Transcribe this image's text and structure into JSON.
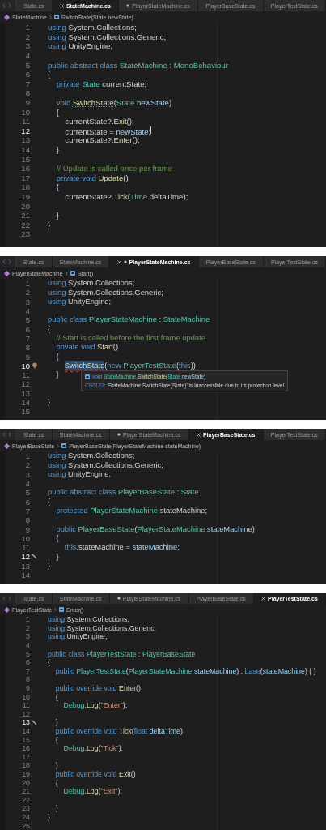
{
  "editors": [
    {
      "tabs": [
        {
          "label": "State.cs",
          "selected": false,
          "modified": false
        },
        {
          "label": "StateMachine.cs",
          "selected": true,
          "modified": false
        },
        {
          "label": "PlayerStateMachine.cs",
          "selected": false,
          "modified": true
        },
        {
          "label": "PlayerBaseState.cs",
          "selected": false,
          "modified": false
        },
        {
          "label": "PlayerTestState.cs",
          "selected": false,
          "modified": false
        }
      ],
      "breadcrumb": {
        "class_name": "StateMachine",
        "member": "SwitchState(State newState)"
      },
      "lines": [
        {
          "number": "1",
          "current": false,
          "tokens": [
            {
              "text": "using",
              "kind": "kw"
            },
            {
              "text": " System.Collections;",
              "kind": "plain"
            }
          ]
        },
        {
          "number": "2",
          "current": false,
          "tokens": [
            {
              "text": "using",
              "kind": "kw"
            },
            {
              "text": " System.Collections.Generic;",
              "kind": "plain"
            }
          ]
        },
        {
          "number": "3",
          "current": false,
          "tokens": [
            {
              "text": "using",
              "kind": "kw"
            },
            {
              "text": " UnityEngine;",
              "kind": "plain"
            }
          ]
        },
        {
          "number": "4",
          "current": false
        },
        {
          "number": "5",
          "current": false,
          "tokens": [
            {
              "text": "public abstract class",
              "kind": "kw"
            },
            {
              "text": " StateMachine",
              "kind": "type"
            },
            {
              "text": " : ",
              "kind": "plain"
            },
            {
              "text": "MonoBehaviour",
              "kind": "type"
            }
          ]
        },
        {
          "number": "6",
          "current": false,
          "tokens": [
            {
              "text": "{",
              "kind": "plain"
            }
          ]
        },
        {
          "number": "7",
          "current": false,
          "tokens": [
            {
              "text": "    private",
              "kind": "kw"
            },
            {
              "text": " State",
              "kind": "type"
            },
            {
              "text": " currentState;",
              "kind": "plain"
            }
          ]
        },
        {
          "number": "8",
          "current": false
        },
        {
          "number": "9",
          "current": false,
          "tokens": [
            {
              "text": "    void",
              "kind": "kw"
            },
            {
              "text": " SwitchState",
              "kind": "fn-hint"
            },
            {
              "text": "(",
              "kind": "plain"
            },
            {
              "text": "State",
              "kind": "type"
            },
            {
              "text": " newState",
              "kind": "var"
            },
            {
              "text": ")",
              "kind": "plain"
            }
          ]
        },
        {
          "number": "10",
          "current": false,
          "tokens": [
            {
              "text": "    {",
              "kind": "plain"
            }
          ]
        },
        {
          "number": "11",
          "current": false,
          "tokens": [
            {
              "text": "        currentState?.",
              "kind": "plain"
            },
            {
              "text": "Exit",
              "kind": "fn"
            },
            {
              "text": "();",
              "kind": "plain"
            }
          ]
        },
        {
          "number": "12",
          "current": true,
          "caret": true,
          "tokens": [
            {
              "text": "        currentState = ",
              "kind": "plain"
            },
            {
              "text": "newState",
              "kind": "var"
            },
            {
              "text": ";",
              "kind": "plain"
            }
          ]
        },
        {
          "number": "13",
          "current": false,
          "tokens": [
            {
              "text": "        currentState?.",
              "kind": "plain"
            },
            {
              "text": "Enter",
              "kind": "fn"
            },
            {
              "text": "();",
              "kind": "plain"
            }
          ]
        },
        {
          "number": "14",
          "current": false,
          "tokens": [
            {
              "text": "    }",
              "kind": "plain"
            }
          ]
        },
        {
          "number": "15",
          "current": false
        },
        {
          "number": "16",
          "current": false,
          "tokens": [
            {
              "text": "    // Update is called once per frame",
              "kind": "comment"
            }
          ]
        },
        {
          "number": "17",
          "current": false,
          "tokens": [
            {
              "text": "    private void",
              "kind": "kw"
            },
            {
              "text": " Update",
              "kind": "fn"
            },
            {
              "text": "()",
              "kind": "plain"
            }
          ]
        },
        {
          "number": "18",
          "current": false,
          "tokens": [
            {
              "text": "    {",
              "kind": "plain"
            }
          ]
        },
        {
          "number": "19",
          "current": false,
          "tokens": [
            {
              "text": "        currentState?.",
              "kind": "plain"
            },
            {
              "text": "Tick",
              "kind": "fn"
            },
            {
              "text": "(",
              "kind": "plain"
            },
            {
              "text": "Time",
              "kind": "type"
            },
            {
              "text": ".deltaTime);",
              "kind": "plain"
            }
          ]
        },
        {
          "number": "20",
          "current": false
        },
        {
          "number": "21",
          "current": false,
          "tokens": [
            {
              "text": "    }",
              "kind": "plain"
            }
          ]
        },
        {
          "number": "22",
          "current": false,
          "tokens": [
            {
              "text": "}",
              "kind": "plain"
            }
          ]
        },
        {
          "number": "23",
          "current": false
        }
      ]
    },
    {
      "tabs": [
        {
          "label": "State.cs",
          "selected": false,
          "modified": false
        },
        {
          "label": "StateMachine.cs",
          "selected": false,
          "modified": false
        },
        {
          "label": "PlayerStateMachine.cs",
          "selected": true,
          "modified": true
        },
        {
          "label": "PlayerBaseState.cs",
          "selected": false,
          "modified": false
        },
        {
          "label": "PlayerTestState.cs",
          "selected": false,
          "modified": false
        }
      ],
      "breadcrumb": {
        "class_name": "PlayerStateMachine",
        "member": "Start()"
      },
      "lines": [
        {
          "number": "1",
          "current": false,
          "tokens": [
            {
              "text": "using",
              "kind": "kw"
            },
            {
              "text": " System.Collections;",
              "kind": "plain"
            }
          ]
        },
        {
          "number": "2",
          "current": false,
          "tokens": [
            {
              "text": "using",
              "kind": "kw"
            },
            {
              "text": " System.Collections.Generic;",
              "kind": "plain"
            }
          ]
        },
        {
          "number": "3",
          "current": false,
          "tokens": [
            {
              "text": "using",
              "kind": "kw"
            },
            {
              "text": " UnityEngine;",
              "kind": "plain"
            }
          ]
        },
        {
          "number": "4",
          "current": false
        },
        {
          "number": "5",
          "current": false,
          "tokens": [
            {
              "text": "public class",
              "kind": "kw"
            },
            {
              "text": " PlayerStateMachine",
              "kind": "type"
            },
            {
              "text": " : ",
              "kind": "plain"
            },
            {
              "text": "StateMachine",
              "kind": "type"
            }
          ]
        },
        {
          "number": "6",
          "current": false,
          "tokens": [
            {
              "text": "{",
              "kind": "plain"
            }
          ]
        },
        {
          "number": "7",
          "current": false,
          "tokens": [
            {
              "text": "    // Start is called before the first frame update",
              "kind": "comment"
            }
          ]
        },
        {
          "number": "8",
          "current": false,
          "tokens": [
            {
              "text": "    private void",
              "kind": "kw"
            },
            {
              "text": " Start",
              "kind": "fn"
            },
            {
              "text": "()",
              "kind": "plain"
            }
          ]
        },
        {
          "number": "9",
          "current": false,
          "tokens": [
            {
              "text": "    {",
              "kind": "plain"
            }
          ]
        },
        {
          "number": "10",
          "current": true,
          "gutter_icon": {
            "kind": "lightbulb"
          },
          "tokens": [
            {
              "text": "        SwitchState",
              "kind": "fn-error"
            },
            {
              "text": "(",
              "kind": "plain"
            },
            {
              "text": "new",
              "kind": "kw"
            },
            {
              "text": " PlayerTestState",
              "kind": "type"
            },
            {
              "text": "(",
              "kind": "plain"
            },
            {
              "text": "this",
              "kind": "kw"
            },
            {
              "text": "));",
              "kind": "plain"
            }
          ]
        },
        {
          "number": "11",
          "current": false,
          "tokens": [
            {
              "text": "    }",
              "kind": "plain"
            }
          ]
        },
        {
          "number": "12",
          "current": false
        },
        {
          "number": "13",
          "current": false
        },
        {
          "number": "14",
          "current": false,
          "tokens": [
            {
              "text": "}",
              "kind": "plain"
            }
          ]
        },
        {
          "number": "15",
          "current": false
        }
      ],
      "tooltip": {
        "signature": [
          {
            "text": "void",
            "kind": "kw"
          },
          {
            "text": " StateMachine",
            "kind": "type"
          },
          {
            "text": ".",
            "kind": "plain"
          },
          {
            "text": "SwitchState",
            "kind": "fn"
          },
          {
            "text": "(",
            "kind": "plain"
          },
          {
            "text": "State",
            "kind": "type"
          },
          {
            "text": " newState",
            "kind": "var"
          },
          {
            "text": ")",
            "kind": "plain"
          }
        ],
        "error": [
          {
            "text": "CS0122",
            "kind": "link"
          },
          {
            "text": ": 'StateMachine.SwitchState(State)' is inaccessible due to its protection level",
            "kind": "plain"
          }
        ]
      }
    },
    {
      "tabs": [
        {
          "label": "State.cs",
          "selected": false,
          "modified": false
        },
        {
          "label": "StateMachine.cs",
          "selected": false,
          "modified": false
        },
        {
          "label": "PlayerStateMachine.cs",
          "selected": false,
          "modified": true
        },
        {
          "label": "PlayerBaseState.cs",
          "selected": true,
          "modified": false
        },
        {
          "label": "PlayerTestState.cs",
          "selected": false,
          "modified": false
        }
      ],
      "breadcrumb": {
        "class_name": "PlayerBaseState",
        "member": "PlayerBaseState(PlayerStateMachine stateMachine)"
      },
      "lines": [
        {
          "number": "1",
          "current": false,
          "tokens": [
            {
              "text": "using",
              "kind": "kw"
            },
            {
              "text": " System.Collections;",
              "kind": "plain"
            }
          ]
        },
        {
          "number": "2",
          "current": false,
          "tokens": [
            {
              "text": "using",
              "kind": "kw"
            },
            {
              "text": " System.Collections.Generic;",
              "kind": "plain"
            }
          ]
        },
        {
          "number": "3",
          "current": false,
          "tokens": [
            {
              "text": "using",
              "kind": "kw"
            },
            {
              "text": " UnityEngine;",
              "kind": "plain"
            }
          ]
        },
        {
          "number": "4",
          "current": false
        },
        {
          "number": "5",
          "current": false,
          "tokens": [
            {
              "text": "public abstract class",
              "kind": "kw"
            },
            {
              "text": " PlayerBaseState",
              "kind": "type"
            },
            {
              "text": " : ",
              "kind": "plain"
            },
            {
              "text": "State",
              "kind": "type"
            }
          ]
        },
        {
          "number": "6",
          "current": false,
          "tokens": [
            {
              "text": "{",
              "kind": "plain"
            }
          ]
        },
        {
          "number": "7",
          "current": false,
          "tokens": [
            {
              "text": "    protected",
              "kind": "kw"
            },
            {
              "text": " PlayerStateMachine",
              "kind": "type"
            },
            {
              "text": " stateMachine;",
              "kind": "plain"
            }
          ]
        },
        {
          "number": "8",
          "current": false
        },
        {
          "number": "9",
          "current": false,
          "tokens": [
            {
              "text": "    public",
              "kind": "kw"
            },
            {
              "text": " PlayerBaseState",
              "kind": "type"
            },
            {
              "text": "(",
              "kind": "plain"
            },
            {
              "text": "PlayerStateMachine",
              "kind": "type"
            },
            {
              "text": " stateMachine",
              "kind": "var"
            },
            {
              "text": ")",
              "kind": "plain"
            }
          ]
        },
        {
          "number": "10",
          "current": false,
          "tokens": [
            {
              "text": "    {",
              "kind": "plain"
            }
          ]
        },
        {
          "number": "11",
          "current": false,
          "tokens": [
            {
              "text": "        this",
              "kind": "kw"
            },
            {
              "text": ".stateMachine = ",
              "kind": "plain"
            },
            {
              "text": "stateMachine",
              "kind": "var"
            },
            {
              "text": ";",
              "kind": "plain"
            }
          ]
        },
        {
          "number": "12",
          "current": true,
          "gutter_icon": {
            "kind": "pencil"
          },
          "tokens": [
            {
              "text": "    }",
              "kind": "plain"
            }
          ]
        },
        {
          "number": "13",
          "current": false,
          "tokens": [
            {
              "text": "}",
              "kind": "plain"
            }
          ]
        },
        {
          "number": "14",
          "current": false
        }
      ]
    },
    {
      "tabs": [
        {
          "label": "State.cs",
          "selected": false,
          "modified": false
        },
        {
          "label": "StateMachine.cs",
          "selected": false,
          "modified": false
        },
        {
          "label": "PlayerStateMachine.cs",
          "selected": false,
          "modified": true
        },
        {
          "label": "PlayerBaseState.cs",
          "selected": false,
          "modified": false
        },
        {
          "label": "PlayerTestState.cs",
          "selected": true,
          "modified": false
        }
      ],
      "breadcrumb": {
        "class_name": "PlayerTestState",
        "member": "Enter()"
      },
      "lines": [
        {
          "number": "1",
          "current": false,
          "tokens": [
            {
              "text": "using",
              "kind": "kw"
            },
            {
              "text": " System.Collections;",
              "kind": "plain"
            }
          ]
        },
        {
          "number": "2",
          "current": false,
          "tokens": [
            {
              "text": "using",
              "kind": "kw"
            },
            {
              "text": " System.Collections.Generic;",
              "kind": "plain"
            }
          ]
        },
        {
          "number": "3",
          "current": false,
          "tokens": [
            {
              "text": "using",
              "kind": "kw"
            },
            {
              "text": " UnityEngine;",
              "kind": "plain"
            }
          ]
        },
        {
          "number": "4",
          "current": false
        },
        {
          "number": "5",
          "current": false,
          "tokens": [
            {
              "text": "public class",
              "kind": "kw"
            },
            {
              "text": " PlayerTestState",
              "kind": "type"
            },
            {
              "text": " : ",
              "kind": "plain"
            },
            {
              "text": "PlayerBaseState",
              "kind": "type"
            }
          ]
        },
        {
          "number": "6",
          "current": false,
          "tokens": [
            {
              "text": "{",
              "kind": "plain"
            }
          ]
        },
        {
          "number": "7",
          "current": false,
          "tokens": [
            {
              "text": "    public",
              "kind": "kw"
            },
            {
              "text": " PlayerTestState",
              "kind": "type"
            },
            {
              "text": "(",
              "kind": "plain"
            },
            {
              "text": "PlayerStateMachine",
              "kind": "type"
            },
            {
              "text": " stateMachine",
              "kind": "var"
            },
            {
              "text": ") : ",
              "kind": "plain"
            },
            {
              "text": "base",
              "kind": "kw"
            },
            {
              "text": "(",
              "kind": "plain"
            },
            {
              "text": "stateMachine",
              "kind": "var"
            },
            {
              "text": ") { }",
              "kind": "plain"
            }
          ]
        },
        {
          "number": "8",
          "current": false
        },
        {
          "number": "9",
          "current": false,
          "tokens": [
            {
              "text": "    public override void",
              "kind": "kw"
            },
            {
              "text": " Enter",
              "kind": "fn"
            },
            {
              "text": "()",
              "kind": "plain"
            }
          ]
        },
        {
          "number": "10",
          "current": false,
          "tokens": [
            {
              "text": "    {",
              "kind": "plain"
            }
          ]
        },
        {
          "number": "11",
          "current": false,
          "tokens": [
            {
              "text": "        Debug",
              "kind": "type"
            },
            {
              "text": ".",
              "kind": "plain"
            },
            {
              "text": "Log",
              "kind": "fn"
            },
            {
              "text": "(",
              "kind": "plain"
            },
            {
              "text": "\"Enter\"",
              "kind": "str"
            },
            {
              "text": ");",
              "kind": "plain"
            }
          ]
        },
        {
          "number": "12",
          "current": false
        },
        {
          "number": "13",
          "current": true,
          "gutter_icon": {
            "kind": "pencil"
          },
          "tokens": [
            {
              "text": "    }",
              "kind": "plain"
            }
          ]
        },
        {
          "number": "14",
          "current": false,
          "tokens": [
            {
              "text": "    public override void",
              "kind": "kw"
            },
            {
              "text": " Tick",
              "kind": "fn"
            },
            {
              "text": "(",
              "kind": "plain"
            },
            {
              "text": "float",
              "kind": "kw"
            },
            {
              "text": " deltaTime",
              "kind": "var"
            },
            {
              "text": ")",
              "kind": "plain"
            }
          ]
        },
        {
          "number": "15",
          "current": false,
          "tokens": [
            {
              "text": "    {",
              "kind": "plain"
            }
          ]
        },
        {
          "number": "16",
          "current": false,
          "tokens": [
            {
              "text": "        Debug",
              "kind": "type"
            },
            {
              "text": ".",
              "kind": "plain"
            },
            {
              "text": "Log",
              "kind": "fn"
            },
            {
              "text": "(",
              "kind": "plain"
            },
            {
              "text": "\"Tick\"",
              "kind": "str"
            },
            {
              "text": ");",
              "kind": "plain"
            }
          ]
        },
        {
          "number": "17",
          "current": false
        },
        {
          "number": "18",
          "current": false,
          "tokens": [
            {
              "text": "    }",
              "kind": "plain"
            }
          ]
        },
        {
          "number": "19",
          "current": false,
          "tokens": [
            {
              "text": "    public override void",
              "kind": "kw"
            },
            {
              "text": " Exit",
              "kind": "fn"
            },
            {
              "text": "()",
              "kind": "plain"
            }
          ]
        },
        {
          "number": "20",
          "current": false,
          "tokens": [
            {
              "text": "    {",
              "kind": "plain"
            }
          ]
        },
        {
          "number": "21",
          "current": false,
          "tokens": [
            {
              "text": "        Debug",
              "kind": "type"
            },
            {
              "text": ".",
              "kind": "plain"
            },
            {
              "text": "Log",
              "kind": "fn"
            },
            {
              "text": "(",
              "kind": "plain"
            },
            {
              "text": "\"Exit\"",
              "kind": "str"
            },
            {
              "text": ");",
              "kind": "plain"
            }
          ]
        },
        {
          "number": "22",
          "current": false
        },
        {
          "number": "23",
          "current": false,
          "tokens": [
            {
              "text": "    }",
              "kind": "plain"
            }
          ]
        },
        {
          "number": "24",
          "current": false,
          "tokens": [
            {
              "text": "}",
              "kind": "plain"
            }
          ]
        },
        {
          "number": "25",
          "current": false
        }
      ]
    }
  ]
}
